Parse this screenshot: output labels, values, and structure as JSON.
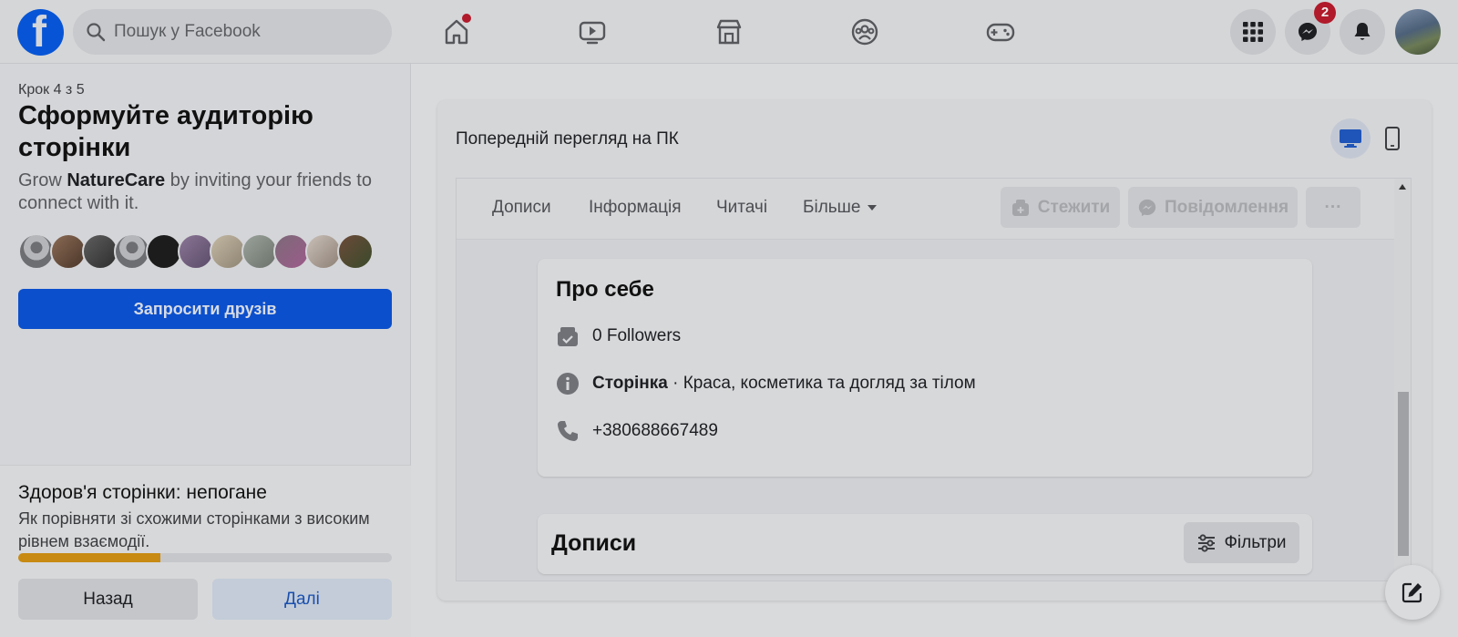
{
  "header": {
    "search_placeholder": "Пошук у Facebook",
    "messenger_badge": "2",
    "nav_icons": [
      "home-icon",
      "watch-icon",
      "marketplace-icon",
      "groups-icon",
      "gaming-icon"
    ]
  },
  "left_panel": {
    "step": "Крок 4 з 5",
    "heading": "Сформуйте аудиторію сторінки",
    "grow_prefix": "Grow ",
    "page_name": "NatureCare",
    "grow_suffix": " by inviting your friends to connect with it.",
    "invite_button": "Запросити друзів",
    "health_title": "Здоров'я сторінки: непогане",
    "health_desc": "Як порівняти зі схожими сторінками з високим рівнем взаємодії.",
    "health_progress": 0.38,
    "back_button": "Назад",
    "next_button": "Далі"
  },
  "preview": {
    "title": "Попередній перегляд на ПК",
    "tabs": [
      "Дописи",
      "Інформація",
      "Читачі",
      "Більше"
    ],
    "follow_button": "Стежити",
    "message_button": "Повідомлення",
    "more_button": "···",
    "about": {
      "title": "Про себе",
      "followers": "0 Followers",
      "page_label": "Сторінка",
      "page_category": " · Краса, косметика та догляд за тілом",
      "phone": "+380688667489"
    },
    "posts_title": "Дописи",
    "filters_button": "Фільтри"
  },
  "colors": {
    "brand_blue": "#0c4fcc",
    "badge_red": "#b01a2a",
    "progress": "#c88a12"
  }
}
